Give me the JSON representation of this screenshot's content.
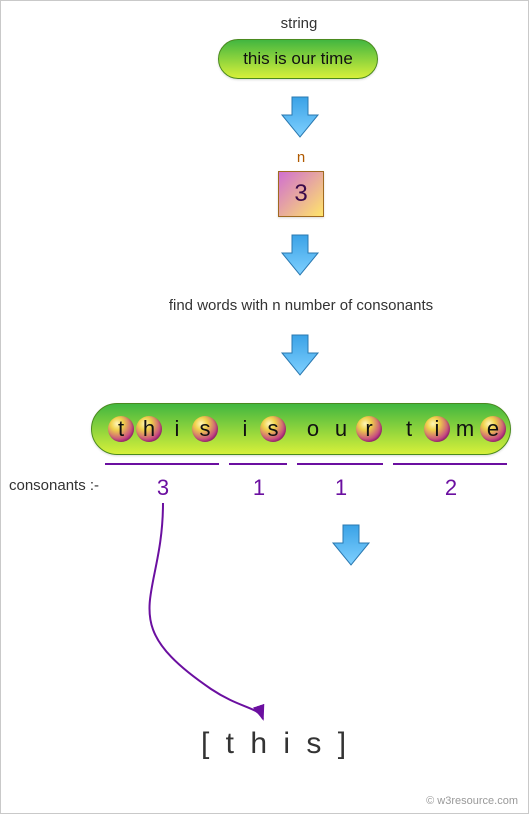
{
  "labels": {
    "string": "string",
    "n": "n",
    "find": "find words with n number of consonants",
    "consonants": "consonants :-"
  },
  "input_string": "this is our time",
  "n_value": "3",
  "words": [
    {
      "text": "this",
      "letters": [
        "t",
        "h",
        "i",
        "s"
      ],
      "highlighted": [
        true,
        true,
        false,
        true
      ],
      "consonants": "3"
    },
    {
      "text": "is",
      "letters": [
        "i",
        "s"
      ],
      "highlighted": [
        false,
        true
      ],
      "consonants": "1"
    },
    {
      "text": "our",
      "letters": [
        "o",
        "u",
        "r"
      ],
      "highlighted": [
        false,
        false,
        true
      ],
      "consonants": "1"
    },
    {
      "text": "time",
      "letters": [
        "t",
        "i",
        "m",
        "e"
      ],
      "highlighted": [
        false,
        true,
        false,
        true
      ],
      "consonants": "2"
    }
  ],
  "result": "[ t h i s ]",
  "watermark": "© w3resource.com",
  "chart_data": {
    "type": "table",
    "title": "find words with n number of consonants",
    "input": "this is our time",
    "n": 3,
    "rows": [
      {
        "word": "this",
        "consonant_count": 3,
        "selected": true
      },
      {
        "word": "is",
        "consonant_count": 1,
        "selected": false
      },
      {
        "word": "our",
        "consonant_count": 1,
        "selected": false
      },
      {
        "word": "time",
        "consonant_count": 2,
        "selected": false
      }
    ],
    "output": [
      "this"
    ]
  }
}
